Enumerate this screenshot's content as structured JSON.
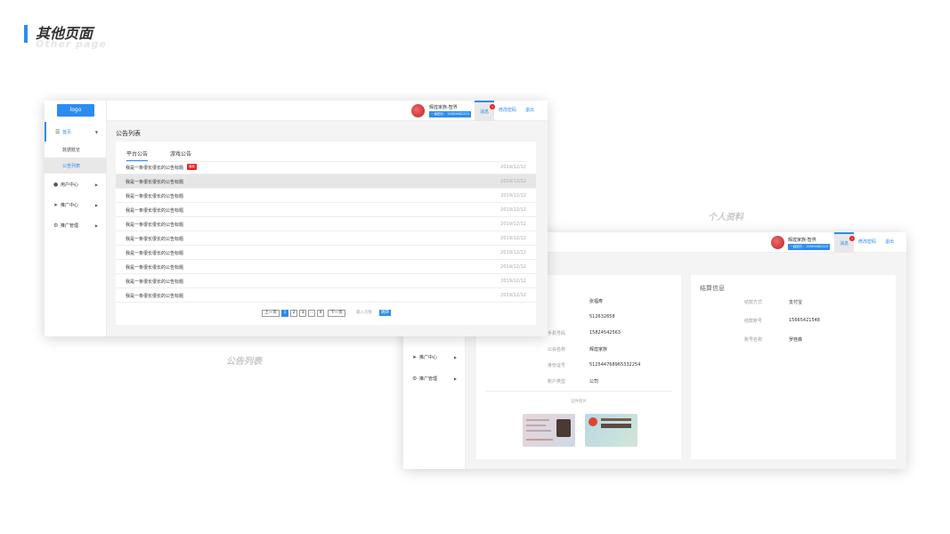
{
  "page": {
    "title": "其他页面",
    "subtitle": "Other page"
  },
  "captions": {
    "notice_list": "公告列表",
    "profile": "个人资料"
  },
  "header": {
    "user_name": "辉煌家族-智界",
    "user_phone": "一级团长：15605682223",
    "buttons": {
      "messages": "消息",
      "change_password": "修改密码",
      "logout": "退出"
    },
    "badge_count": "3"
  },
  "sidebar": {
    "logo": "logo",
    "items": [
      {
        "label": "首页",
        "icon": "list-icon"
      },
      {
        "label": "用户中心",
        "icon": "user-icon"
      },
      {
        "label": "推广中心",
        "icon": "send-icon"
      },
      {
        "label": "推广管理",
        "icon": "gear-icon"
      }
    ],
    "sub_items": [
      "数据概览",
      "公告列表"
    ]
  },
  "notice": {
    "title": "公告列表",
    "tabs": [
      "平台公告",
      "游戏公告"
    ],
    "new_badge": "最新",
    "rows": [
      {
        "title": "我是一条很长很长的公告标题",
        "date": "2019/12/12"
      },
      {
        "title": "我是一条很长很长的公告标题",
        "date": "2019/12/12"
      },
      {
        "title": "我是一条很长很长的公告标题",
        "date": "2019/12/12"
      },
      {
        "title": "我是一条很长很长的公告标题",
        "date": "2019/12/12"
      },
      {
        "title": "我是一条很长很长的公告标题",
        "date": "2019/12/12"
      },
      {
        "title": "我是一条很长很长的公告标题",
        "date": "2019/12/12"
      },
      {
        "title": "我是一条很长很长的公告标题",
        "date": "2019/12/12"
      },
      {
        "title": "我是一条很长很长的公告标题",
        "date": "2019/12/12"
      },
      {
        "title": "我是一条很长很长的公告标题",
        "date": "2019/12/12"
      },
      {
        "title": "我是一条很长很长的公告标题",
        "date": "2019/12/12"
      }
    ],
    "pager": {
      "prev": "上一页",
      "pages": [
        "1",
        "2",
        "3",
        "...",
        "4"
      ],
      "next": "下一页",
      "input_placeholder": "输入页数",
      "go": "跳转"
    }
  },
  "profile": {
    "menu": [
      "推广中心",
      "推广管理"
    ],
    "left_fields": [
      {
        "key": "",
        "value": "张福寿"
      },
      {
        "key": "",
        "value": "512632658"
      },
      {
        "key": "手机号码",
        "value": "15824542563"
      },
      {
        "key": "公会名称",
        "value": "辉煌家族"
      },
      {
        "key": "身份证号",
        "value": "512544768965332254"
      },
      {
        "key": "账户类型",
        "value": "公司"
      }
    ],
    "id_photo_label": "证件照片",
    "settle_title": "结算信息",
    "right_fields": [
      {
        "key": "结款方式",
        "value": "支付宝"
      },
      {
        "key": "结款账号",
        "value": "15665421548"
      },
      {
        "key": "账号名称",
        "value": "罗桂森"
      }
    ]
  },
  "colors": {
    "accent": "#2d8cf0",
    "badge": "#e22222"
  }
}
